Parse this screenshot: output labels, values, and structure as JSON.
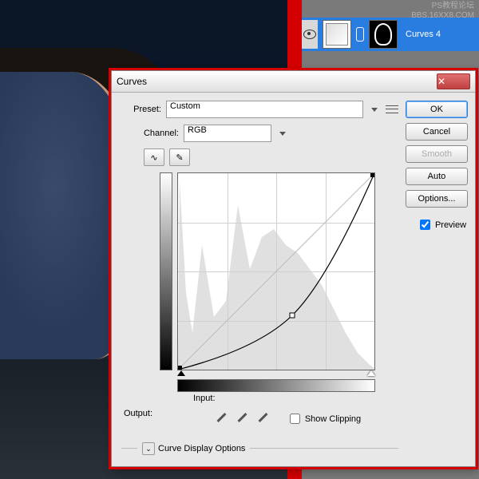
{
  "watermark": {
    "line1": "PS教程论坛",
    "line2": "BBS.16XX8.COM"
  },
  "layers": {
    "name": "Curves 4"
  },
  "dialog": {
    "title": "Curves",
    "preset_label": "Preset:",
    "preset_value": "Custom",
    "channel_label": "Channel:",
    "channel_value": "RGB",
    "output_label": "Output:",
    "input_label": "Input:",
    "show_clipping": "Show Clipping",
    "curve_display_options": "Curve Display Options"
  },
  "buttons": {
    "ok": "OK",
    "cancel": "Cancel",
    "smooth": "Smooth",
    "auto": "Auto",
    "options": "Options...",
    "preview": "Preview"
  },
  "chart_data": {
    "type": "line",
    "title": "Curves",
    "xlabel": "Input",
    "ylabel": "Output",
    "xlim": [
      0,
      255
    ],
    "ylim": [
      0,
      255
    ],
    "series": [
      {
        "name": "tone-curve",
        "x": [
          0,
          148,
          255
        ],
        "y": [
          0,
          70,
          255
        ]
      },
      {
        "name": "identity",
        "x": [
          0,
          255
        ],
        "y": [
          0,
          255
        ]
      }
    ],
    "histogram_peaks_x": [
      5,
      15,
      30,
      55,
      80,
      110,
      135,
      160,
      185,
      210,
      235,
      250
    ],
    "histogram_peaks_y": [
      240,
      80,
      150,
      90,
      220,
      180,
      160,
      140,
      120,
      70,
      30,
      10
    ]
  },
  "preview_checked": true,
  "show_clipping_checked": false
}
